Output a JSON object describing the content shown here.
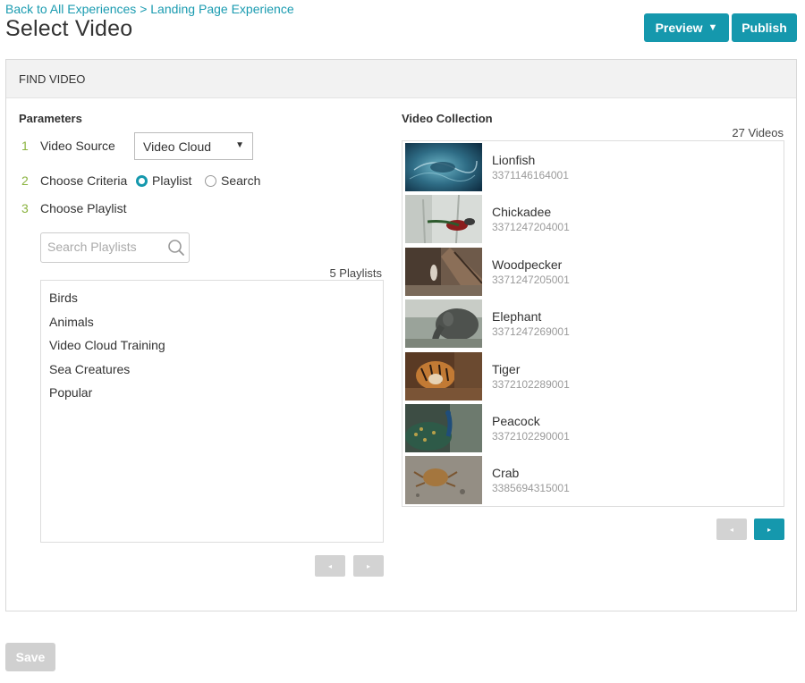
{
  "breadcrumb": {
    "back": "Back to All Experiences",
    "separator": ">",
    "current": "Landing Page Experience"
  },
  "page_title": "Select Video",
  "header_buttons": {
    "preview": "Preview",
    "preview_caret": "▼",
    "publish": "Publish"
  },
  "panel": {
    "header": "FIND VIDEO"
  },
  "parameters": {
    "title": "Parameters",
    "steps": [
      {
        "num": "1",
        "label": "Video Source"
      },
      {
        "num": "2",
        "label": "Choose Criteria"
      },
      {
        "num": "3",
        "label": "Choose Playlist"
      }
    ],
    "video_source": {
      "selected": "Video Cloud",
      "arrow": "▼"
    },
    "criteria": {
      "option_playlist": "Playlist",
      "option_search": "Search",
      "selected": "Playlist"
    },
    "search": {
      "placeholder": "Search Playlists",
      "value": ""
    },
    "playlist_count": "5 Playlists",
    "playlists": [
      "Birds",
      "Animals",
      "Video Cloud Training",
      "Sea Creatures",
      "Popular"
    ],
    "pager": {
      "prev": "◂",
      "next": "▸"
    }
  },
  "collection": {
    "title": "Video Collection",
    "count": "27 Videos",
    "videos": [
      {
        "name": "Lionfish",
        "id": "3371146164001"
      },
      {
        "name": "Chickadee",
        "id": "3371247204001"
      },
      {
        "name": "Woodpecker",
        "id": "3371247205001"
      },
      {
        "name": "Elephant",
        "id": "3371247269001"
      },
      {
        "name": "Tiger",
        "id": "3372102289001"
      },
      {
        "name": "Peacock",
        "id": "3372102290001"
      },
      {
        "name": "Crab",
        "id": "3385694315001"
      }
    ],
    "pager": {
      "prev": "◂",
      "next": "▸"
    }
  },
  "save_button": "Save",
  "colors": {
    "accent": "#1598ad",
    "step_number": "#8ab33f",
    "link": "#1a9bb0",
    "disabled": "#d0d0d0"
  }
}
